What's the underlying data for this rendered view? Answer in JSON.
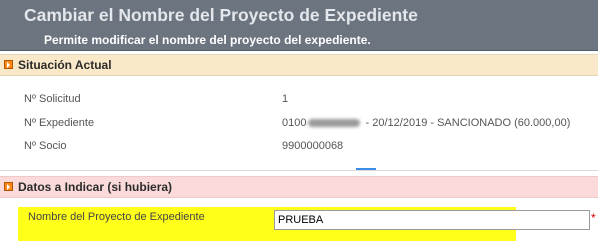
{
  "header": {
    "title": "Cambiar el Nombre del Proyecto de Expediente",
    "subtitle": "Permite modificar el nombre del proyecto del expediente."
  },
  "situacion": {
    "title": "Situación Actual",
    "rows": [
      {
        "label": "Nº Solicitud",
        "value": "1"
      },
      {
        "label": "Nº Expediente",
        "value_prefix": "0100",
        "value_suffix": " - 20/12/2019 - SANCIONADO (60.000,00)"
      },
      {
        "label": "Nº Socio",
        "value": "9900000068"
      }
    ]
  },
  "datos": {
    "title": "Datos a Indicar (si hubiera)",
    "field_label": "Nombre del Proyecto de Expediente",
    "field_value": "PRUEBA",
    "required_mark": "*"
  }
}
